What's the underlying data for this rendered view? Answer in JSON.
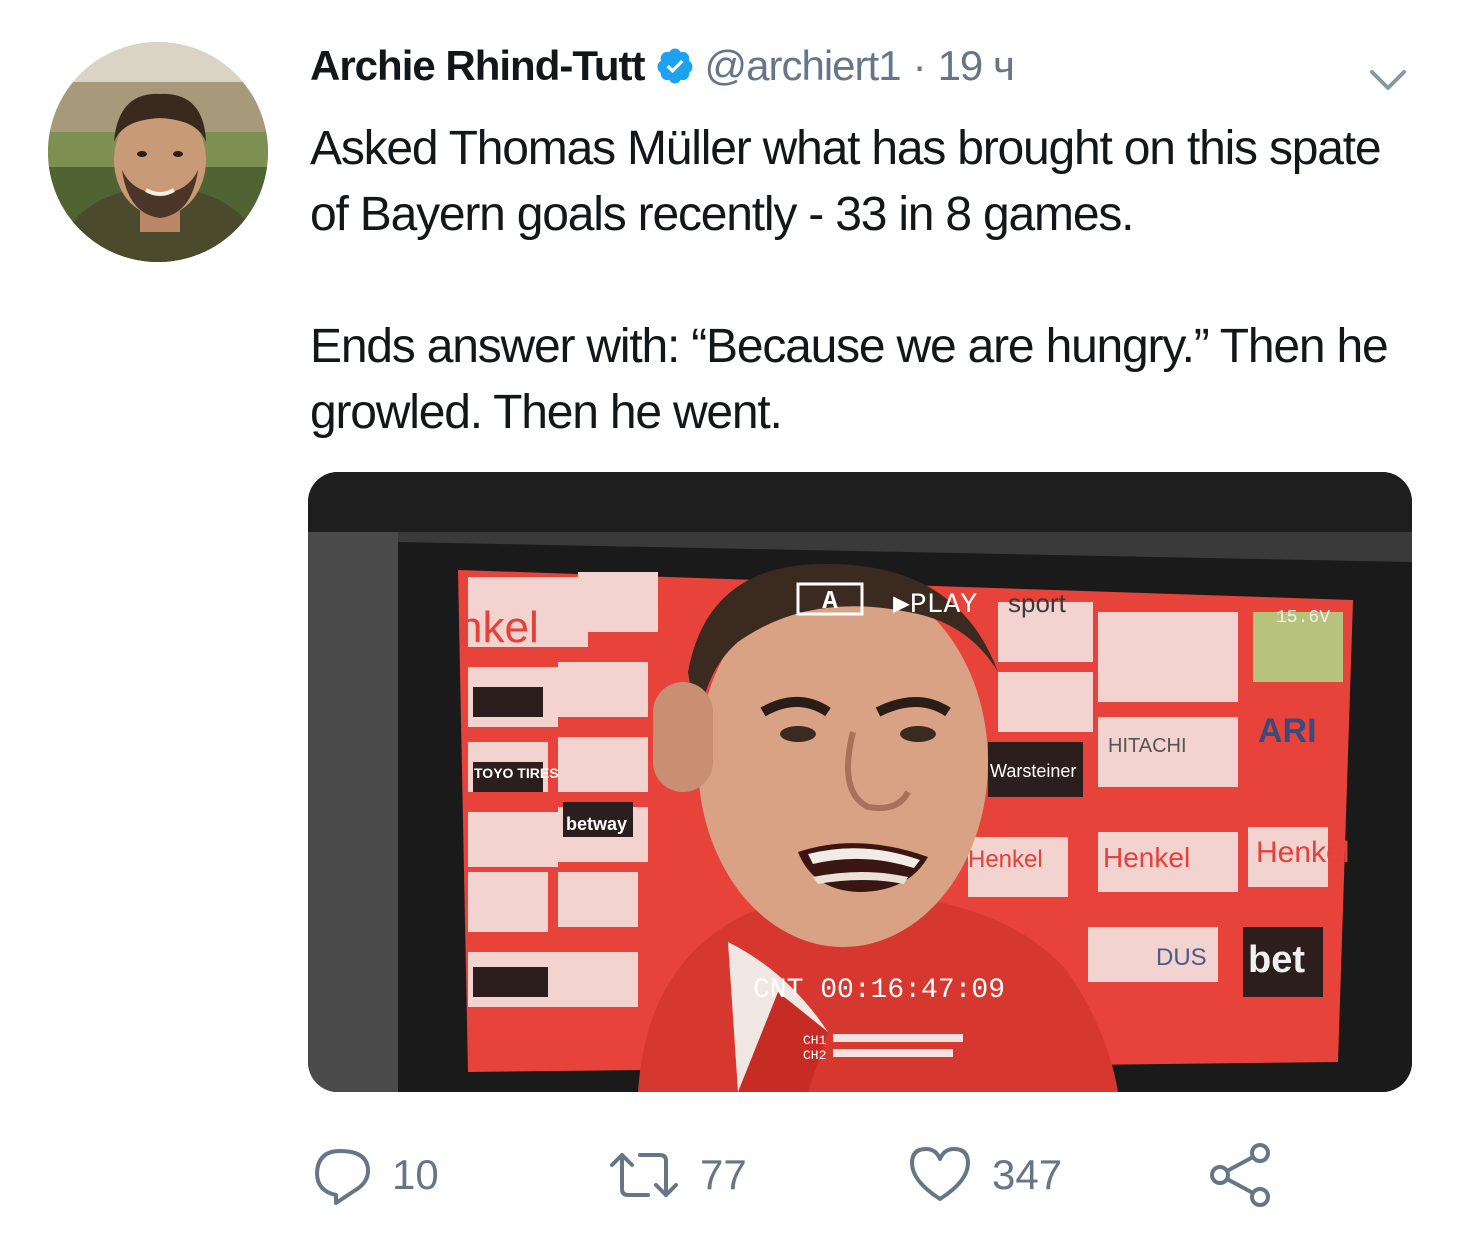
{
  "tweet": {
    "display_name": "Archie Rhind-Tutt",
    "handle": "@archiert1",
    "separator": "·",
    "time": "19 ч",
    "verified": true,
    "text_lines": [
      "Asked Thomas Müller what has brought on this spate of Bayern goals recently - 33 in 8 games.",
      "Ends answer with: “Because we are hungry.” Then he growled. Then he went."
    ],
    "media": {
      "overlay_play": "▶PLAY",
      "overlay_mode": "A",
      "overlay_counter": "CNT 00:16:47:09",
      "overlay_ch1": "CH1",
      "overlay_ch2": "CH2",
      "overlay_voltage": "15.6V",
      "boards": [
        "nkel",
        "Henkel",
        "Henkel",
        "Henkel",
        "HITACHI",
        "Warsteiner",
        "betway",
        "DUS",
        "bet",
        "ARI",
        "sport",
        "TOYO TIRES"
      ]
    }
  },
  "actions": {
    "reply_count": "10",
    "retweet_count": "77",
    "like_count": "347"
  },
  "icons": {
    "verified": "verified-badge-icon",
    "caret": "chevron-down-icon",
    "reply": "reply-icon",
    "retweet": "retweet-icon",
    "like": "heart-icon",
    "share": "share-icon"
  },
  "colors": {
    "text": "#14171a",
    "secondary": "#657786",
    "verified": "#1da1f2"
  }
}
